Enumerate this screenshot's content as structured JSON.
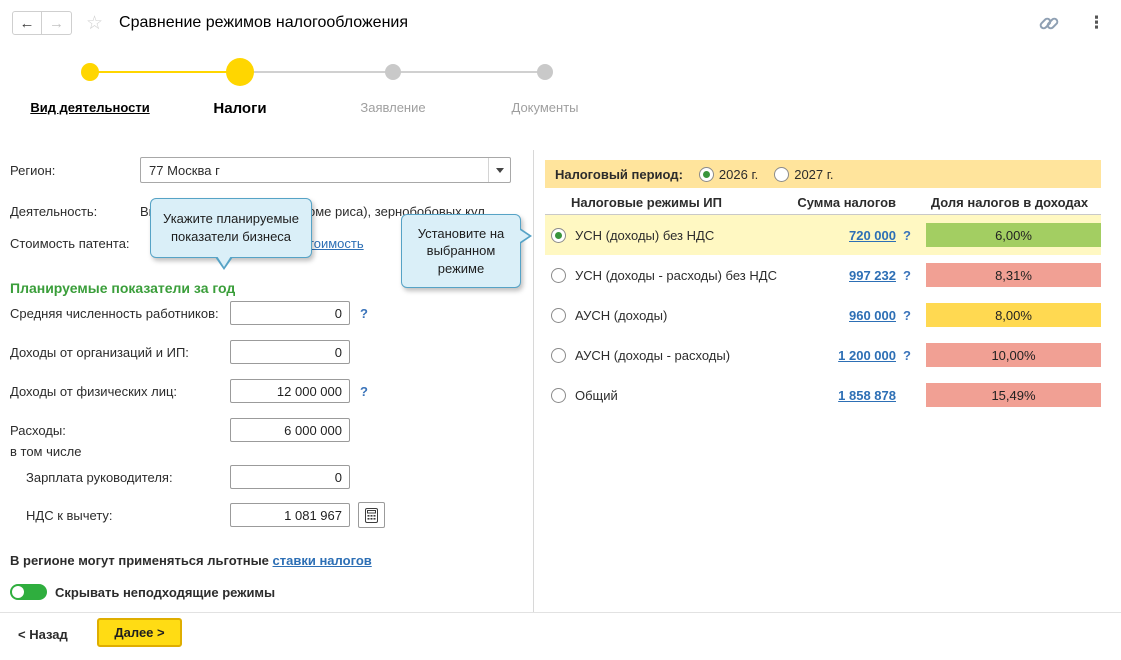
{
  "header": {
    "title": "Сравнение режимов налогообложения"
  },
  "icons": {
    "back": "←",
    "forward": "→",
    "star": "☆",
    "menu_dots": "⋮"
  },
  "colors": {
    "accent_yellow": "#ffd600",
    "period_bar_bg": "#ffe49c",
    "selected_row_bg": "#fff8c2",
    "badge_green": "#a3ce62",
    "badge_yellow": "#ffd951",
    "badge_red": "#f1a094",
    "link_blue": "#2d6fb5",
    "section_green": "#3a9e3a",
    "toggle_green": "#2fae3e",
    "tooltip_bg": "#daeff8",
    "tooltip_border": "#56a3c6"
  },
  "stepper": {
    "steps": [
      {
        "label": "Вид деятельности",
        "state": "completed"
      },
      {
        "label": "Налоги",
        "state": "current"
      },
      {
        "label": "Заявление",
        "state": "upcoming"
      },
      {
        "label": "Документы",
        "state": "upcoming"
      }
    ]
  },
  "tooltips": {
    "planned_indicators": "Укажите планируемые показатели бизнеса",
    "select_regime": "Установите на выбранном режиме"
  },
  "form": {
    "region": {
      "label": "Регион:",
      "value": "77 Москва г"
    },
    "activity": {
      "label": "Деятельность:",
      "value": "Выращивание зерновых (кроме риса), зернобобовых кул..."
    },
    "patent": {
      "label": "Стоимость патента:",
      "link": "Рассчитать стоимость"
    },
    "section_title": "Планируемые показатели за год",
    "fields": [
      {
        "label": "Средняя численность работников:",
        "value": "0",
        "help": "?"
      },
      {
        "label": "Доходы от организаций и ИП:",
        "value": "0",
        "help": ""
      },
      {
        "label": "Доходы от физических лиц:",
        "value": "12 000 000",
        "help": "?"
      },
      {
        "label": "Расходы:",
        "value": "6 000 000",
        "help": ""
      }
    ],
    "including_label": "в том числе",
    "sub_fields": [
      {
        "label": "Зарплата руководителя:",
        "value": "0"
      },
      {
        "label": "НДС к вычету:",
        "value": "1 081 967"
      }
    ],
    "notice_text": "В регионе могут применяться льготные",
    "notice_link": "ставки налогов",
    "toggle_label": "Скрывать неподходящие режимы"
  },
  "table": {
    "period_label": "Налоговый период:",
    "periods": [
      {
        "label": "2026 г.",
        "selected": true
      },
      {
        "label": "2027 г.",
        "selected": false
      }
    ],
    "columns": [
      "Налоговые режимы ИП",
      "Сумма налогов",
      "Доля налогов в доходах"
    ],
    "rows": [
      {
        "name": "УСН (доходы) без НДС",
        "sum": "720 000",
        "help": "?",
        "share": "6,00%",
        "selected": true,
        "badge_style": "background:#a3ce62"
      },
      {
        "name": "УСН (доходы - расходы) без НДС",
        "sum": "997 232",
        "help": "?",
        "share": "8,31%",
        "selected": false,
        "badge_style": "background:#f1a094"
      },
      {
        "name": "АУСН (доходы)",
        "sum": "960 000",
        "help": "?",
        "share": "8,00%",
        "selected": false,
        "badge_style": "background:#ffd951"
      },
      {
        "name": "АУСН (доходы - расходы)",
        "sum": "1 200 000",
        "help": "?",
        "share": "10,00%",
        "selected": false,
        "badge_style": "background:#f1a094"
      },
      {
        "name": "Общий",
        "sum": "1 858 878",
        "help": "",
        "share": "15,49%",
        "selected": false,
        "badge_style": "background:#f1a094"
      }
    ]
  },
  "footer": {
    "back_label": "< Назад",
    "next_label": "Далее >"
  }
}
